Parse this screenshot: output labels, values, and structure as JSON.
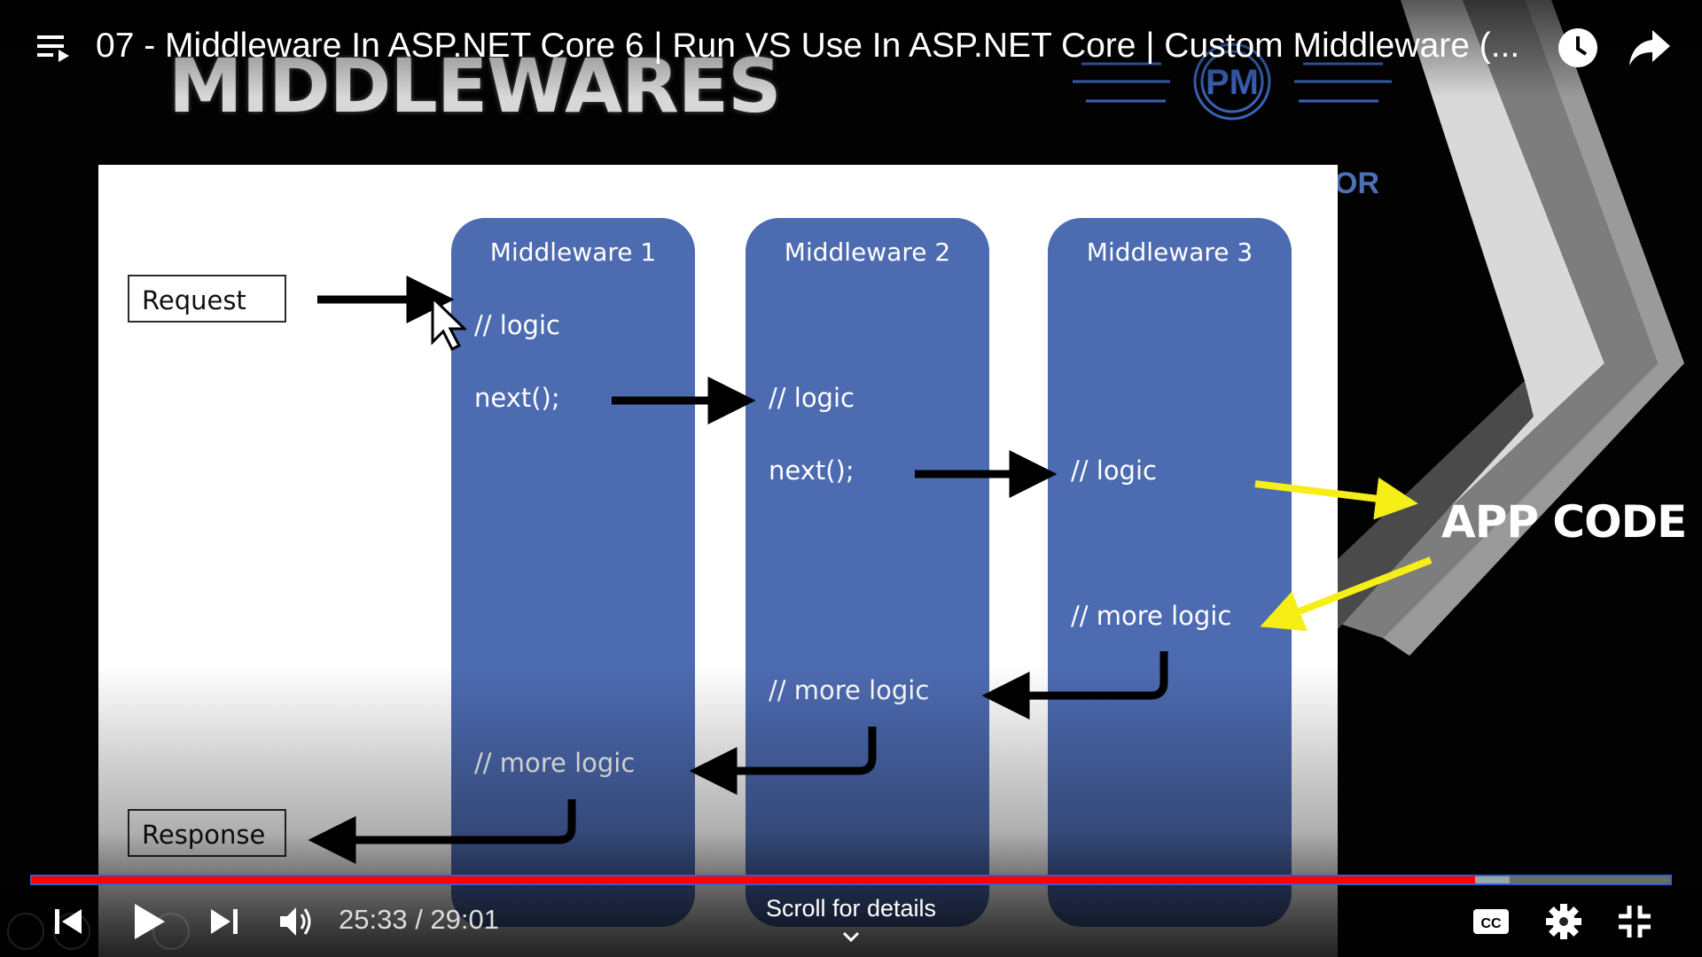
{
  "header": {
    "video_title": "07 - Middleware In ASP.NET Core 6 | Run VS Use In ASP.NET Core | Custom Middleware (..."
  },
  "video_frame": {
    "banner": "MIDDLEWARES",
    "logo_text": "PM",
    "side_fragment": "OR",
    "app_code": "APP CODE",
    "request_label": "Request",
    "response_label": "Response",
    "middlewares": [
      {
        "title": "Middleware 1",
        "lines": [
          "// logic",
          "next();",
          "// more logic"
        ]
      },
      {
        "title": "Middleware 2",
        "lines": [
          "// logic",
          "next();",
          "// more logic"
        ]
      },
      {
        "title": "Middleware 3",
        "lines": [
          "// logic",
          "// more logic"
        ]
      }
    ]
  },
  "player": {
    "time_display": "25:33 / 29:01",
    "scroll_hint": "Scroll for details",
    "progress_played": 0.881,
    "progress_buffered": 0.902
  },
  "icons": {
    "playlist": "playlist-icon",
    "watch_later": "clock-icon",
    "share": "share-icon",
    "previous": "skip-previous-icon",
    "play": "play-icon",
    "next": "skip-next-icon",
    "volume": "volume-icon",
    "captions": "captions-icon",
    "settings": "gear-icon",
    "exit_fullscreen": "exit-fullscreen-icon"
  },
  "colors": {
    "progress_played": "#ff0000",
    "middleware_box": "#4d6bb1",
    "arrow_yellow": "#f5ee17"
  }
}
